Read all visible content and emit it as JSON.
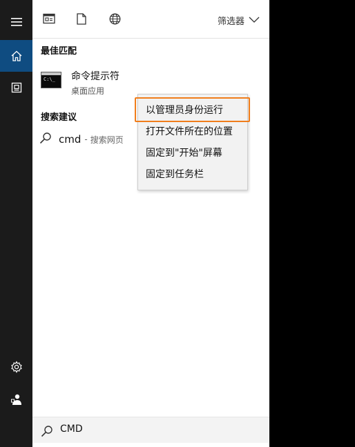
{
  "toolbar": {
    "icons": [
      "document-view-icon",
      "file-icon",
      "globe-icon"
    ],
    "filter_label": "筛选器"
  },
  "rail": {
    "items": [
      "menu-icon",
      "home-icon",
      "recent-icon",
      "settings-icon",
      "user-icon"
    ]
  },
  "best_match": {
    "heading": "最佳匹配",
    "app_name": "命令提示符",
    "app_type": "桌面应用"
  },
  "suggestions": {
    "heading": "搜索建议",
    "query": "cmd",
    "separator": "-",
    "suffix": "搜索网页"
  },
  "context_menu": {
    "items": [
      {
        "label": "以管理员身份运行",
        "highlighted": true
      },
      {
        "label": "打开文件所在的位置",
        "highlighted": false
      },
      {
        "label": "固定到\"开始\"屏幕",
        "highlighted": false
      },
      {
        "label": "固定到任务栏",
        "highlighted": false
      }
    ],
    "highlight_color": "#f07d1a"
  },
  "search": {
    "value": "CMD"
  },
  "colors": {
    "accent": "#0f4c81",
    "rail": "#1b1b1b"
  }
}
